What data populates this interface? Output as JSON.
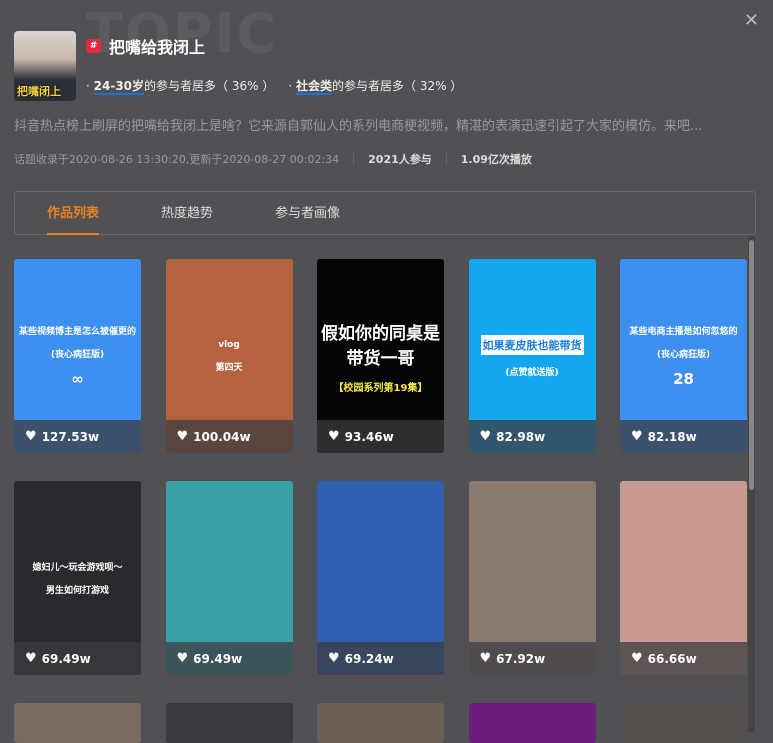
{
  "watermark": "TOPIC",
  "topic": {
    "avatar_caption": "把嘴闭上",
    "title": "把嘴给我闭上",
    "tags": [
      {
        "highlight": "24-30岁",
        "text": "的参与者居多（ 36% ）"
      },
      {
        "highlight": "社会类",
        "text": "的参与者居多（ 32% ）"
      }
    ],
    "description": "抖音热点榜上刷屏的把嘴给我闭上是啥？它来源自郭仙人的系列电商梗视频，精湛的表演迅速引起了大家的模仿。来吧...",
    "record": "话题收录于2020-08-26 13:30:20,更新于2020-08-27 00:02:34",
    "participants": "2021人参与",
    "plays": "1.09亿次播放"
  },
  "tabs": [
    "作品列表",
    "热度趋势",
    "参与者画像"
  ],
  "cards": [
    {
      "likes": "127.53w",
      "bg": "#3d8ff0",
      "lines": [
        "某些视频博主是怎么被催更的",
        "(丧心病狂版)",
        "∞"
      ]
    },
    {
      "likes": "100.04w",
      "bg": "#b5633f",
      "lines": [
        "vlog",
        "第四天"
      ]
    },
    {
      "likes": "93.46w",
      "bg": "#050505",
      "lines": [
        "假如你的同桌是带货一哥",
        "【校园系列第19集】"
      ]
    },
    {
      "likes": "82.98w",
      "bg": "#15a6f0",
      "lines": [
        "如果麦皮肤也能带货",
        "(点赞就送版)"
      ]
    },
    {
      "likes": "82.18w",
      "bg": "#3d8ff0",
      "lines": [
        "某些电商主播是如何忽悠的",
        "(丧心病狂版)",
        "28"
      ]
    },
    {
      "likes": "69.49w",
      "bg": "#2a2a2e",
      "lines": [
        "媳妇儿～玩会游戏呗～",
        "男生如何打游戏"
      ]
    },
    {
      "likes": "69.49w",
      "bg": "#3aa0a8",
      "lines": []
    },
    {
      "likes": "69.24w",
      "bg": "#2f5fb0",
      "lines": []
    },
    {
      "likes": "67.92w",
      "bg": "#8a7a70",
      "lines": []
    },
    {
      "likes": "66.66w",
      "bg": "#c89a90",
      "lines": []
    }
  ]
}
